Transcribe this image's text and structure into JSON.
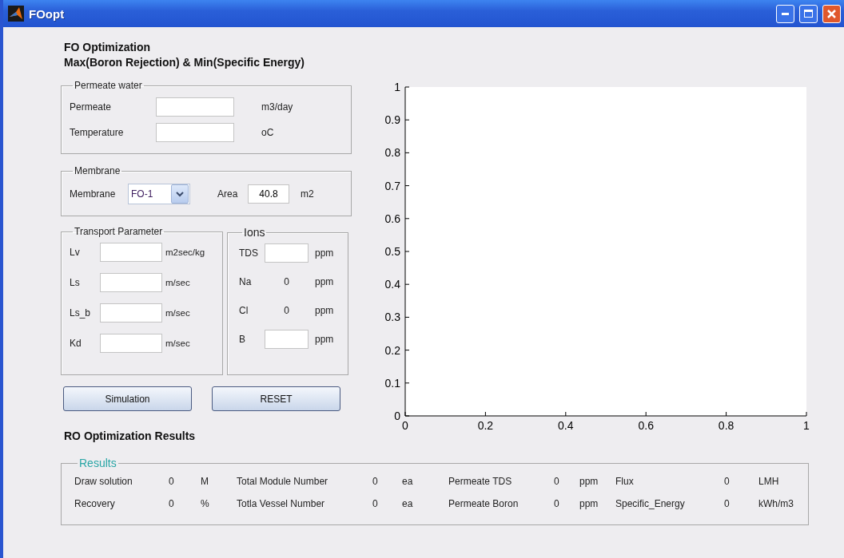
{
  "window": {
    "title": "FOopt"
  },
  "heading": {
    "line_1": "FO Optimization",
    "line_2": "Max(Boron Rejection) & Min(Specific Energy)"
  },
  "permeate_water": {
    "legend": "Permeate water",
    "fields": [
      {
        "label": "Permeate",
        "unit": "m3/day"
      },
      {
        "label": "Temperature",
        "unit": "oC"
      }
    ]
  },
  "membrane": {
    "legend": "Membrane",
    "label": "Membrane",
    "selected_value": "FO-1",
    "area_label": "Area",
    "area_value": "40.8",
    "area_unit": "m2"
  },
  "transport_parameter": {
    "legend": "Transport Parameter",
    "fields": [
      {
        "label": "Lv",
        "unit": "m2sec/kg"
      },
      {
        "label": "Ls",
        "unit": "m/sec"
      },
      {
        "label": "Ls_b",
        "unit": "m/sec"
      },
      {
        "label": "Kd",
        "unit": "m/sec"
      }
    ]
  },
  "ions": {
    "legend": "Ions",
    "rows": [
      {
        "kind": "field",
        "label": "TDS",
        "unit": "ppm"
      },
      {
        "kind": "value",
        "label": "Na",
        "value": "0",
        "unit": "ppm"
      },
      {
        "kind": "value",
        "label": "Cl",
        "value": "0",
        "unit": "ppm"
      },
      {
        "kind": "field",
        "label": "B",
        "unit": "ppm"
      }
    ]
  },
  "buttons": [
    "Simulation",
    "RESET"
  ],
  "results_heading": "RO Optimization Results",
  "chart": {
    "chart_data": {
      "type": "line",
      "xlim": [
        0,
        1
      ],
      "ylim": [
        0,
        1
      ],
      "xticks": [
        0,
        {
          "value": 0.2,
          "label": "0.2"
        },
        {
          "value": 0.4,
          "label": "0.4"
        },
        {
          "value": 0.6,
          "label": "0.6"
        },
        {
          "value": 0.8,
          "label": "0.8"
        },
        1
      ],
      "yticks": [
        0,
        {
          "value": 0.1,
          "label": "0.1"
        },
        {
          "value": 0.2,
          "label": "0.2"
        },
        {
          "value": 0.3,
          "label": "0.3"
        },
        {
          "value": 0.4,
          "label": "0.4"
        },
        {
          "value": 0.5,
          "label": "0.5"
        },
        {
          "value": 0.6,
          "label": "0.6"
        },
        {
          "value": 0.7,
          "label": "0.7"
        },
        {
          "value": 0.8,
          "label": "0.8"
        },
        {
          "value": 0.9,
          "label": "0.9"
        },
        1
      ]
    }
  },
  "results": {
    "legend": "Results",
    "rows": [
      [
        {
          "label": "Draw solution",
          "value": "0",
          "unit": "M"
        },
        {
          "label": "Total Module Number",
          "value": "0",
          "unit": "ea"
        },
        {
          "label": "Permeate TDS",
          "value": "0",
          "unit": "ppm"
        },
        {
          "label": "Flux",
          "value": "0",
          "unit": "LMH"
        }
      ],
      [
        {
          "label": "Recovery",
          "value": "0",
          "unit": "%"
        },
        {
          "label": "Totla Vessel Number",
          "value": "0",
          "unit": "ea"
        },
        {
          "label": "Permeate Boron",
          "value": "0",
          "unit": "ppm"
        },
        {
          "label": "Specific_Energy",
          "value": "0",
          "unit": "kWh/m3"
        }
      ]
    ]
  }
}
